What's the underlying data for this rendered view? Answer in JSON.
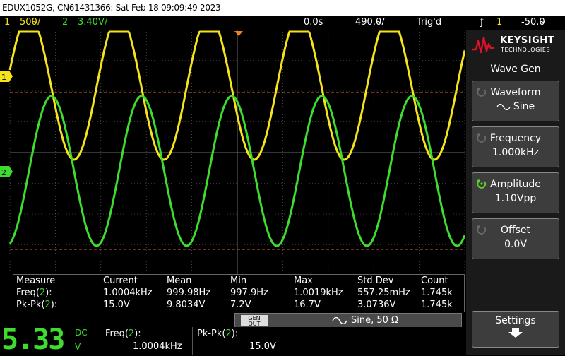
{
  "title_bar": {
    "text": "EDUX1052G, CN61431366: Sat Feb 18 09:09:49 2023"
  },
  "status": {
    "ch1_num": "1",
    "ch1_scale": "500̴/",
    "ch2_num": "2",
    "ch2_scale": "3.40V/",
    "time_delay": "0.0s",
    "time_scale": "490.0̴/",
    "trigger_state": "Trig'd",
    "trigger_icon": "ƒ",
    "trigger_channel": "1",
    "trigger_level": "-50.0̴"
  },
  "markers": {
    "ch1": "1",
    "ch2": "2"
  },
  "measurements": {
    "headers": [
      "Measure",
      "Current",
      "Mean",
      "Min",
      "Max",
      "Std Dev",
      "Count"
    ],
    "rows": [
      {
        "name": "Freq(",
        "ch": "2",
        "close": "):",
        "current": "1.0004kHz",
        "mean": "999.98Hz",
        "min": "997.9Hz",
        "max": "1.0019kHz",
        "std": "557.25mHz",
        "count": "1.745k"
      },
      {
        "name": "Pk-Pk(",
        "ch": "2",
        "close": "):",
        "current": "15.0V",
        "mean": "9.8034V",
        "min": "7.2V",
        "max": "16.7V",
        "std": "3.0736V",
        "count": "1.745k"
      }
    ]
  },
  "wavegen": {
    "gen_out_l1": "GEN",
    "gen_out_l2": "OUT",
    "status": "Sine, 50 Ω"
  },
  "dvm": {
    "reading": "5.33",
    "mode": "DC",
    "unit": "V"
  },
  "quick_meas": [
    {
      "label": "Freq(",
      "ch": "2",
      "close": "):",
      "value": "1.0004kHz"
    },
    {
      "label": "Pk-Pk(",
      "ch": "2",
      "close": "):",
      "value": "15.0V"
    }
  ],
  "sidebar": {
    "brand": "KEYSIGHT",
    "brand_sub": "TECHNOLOGIES",
    "menu_title": "Wave Gen",
    "softkeys": [
      {
        "label": "Waveform",
        "value": "Sine",
        "active": false
      },
      {
        "label": "Frequency",
        "value": "1.000kHz",
        "active": false
      },
      {
        "label": "Amplitude",
        "value": "1.10Vpp",
        "active": true
      },
      {
        "label": "Offset",
        "value": "0.0V",
        "active": false
      }
    ],
    "settings_label": "Settings"
  },
  "colors": {
    "ch1": "#f5e31b",
    "ch2": "#3ddc2f",
    "cursor": "#e05a3a",
    "grid": "#6a6a6a",
    "brand_red": "#e0102a"
  }
}
